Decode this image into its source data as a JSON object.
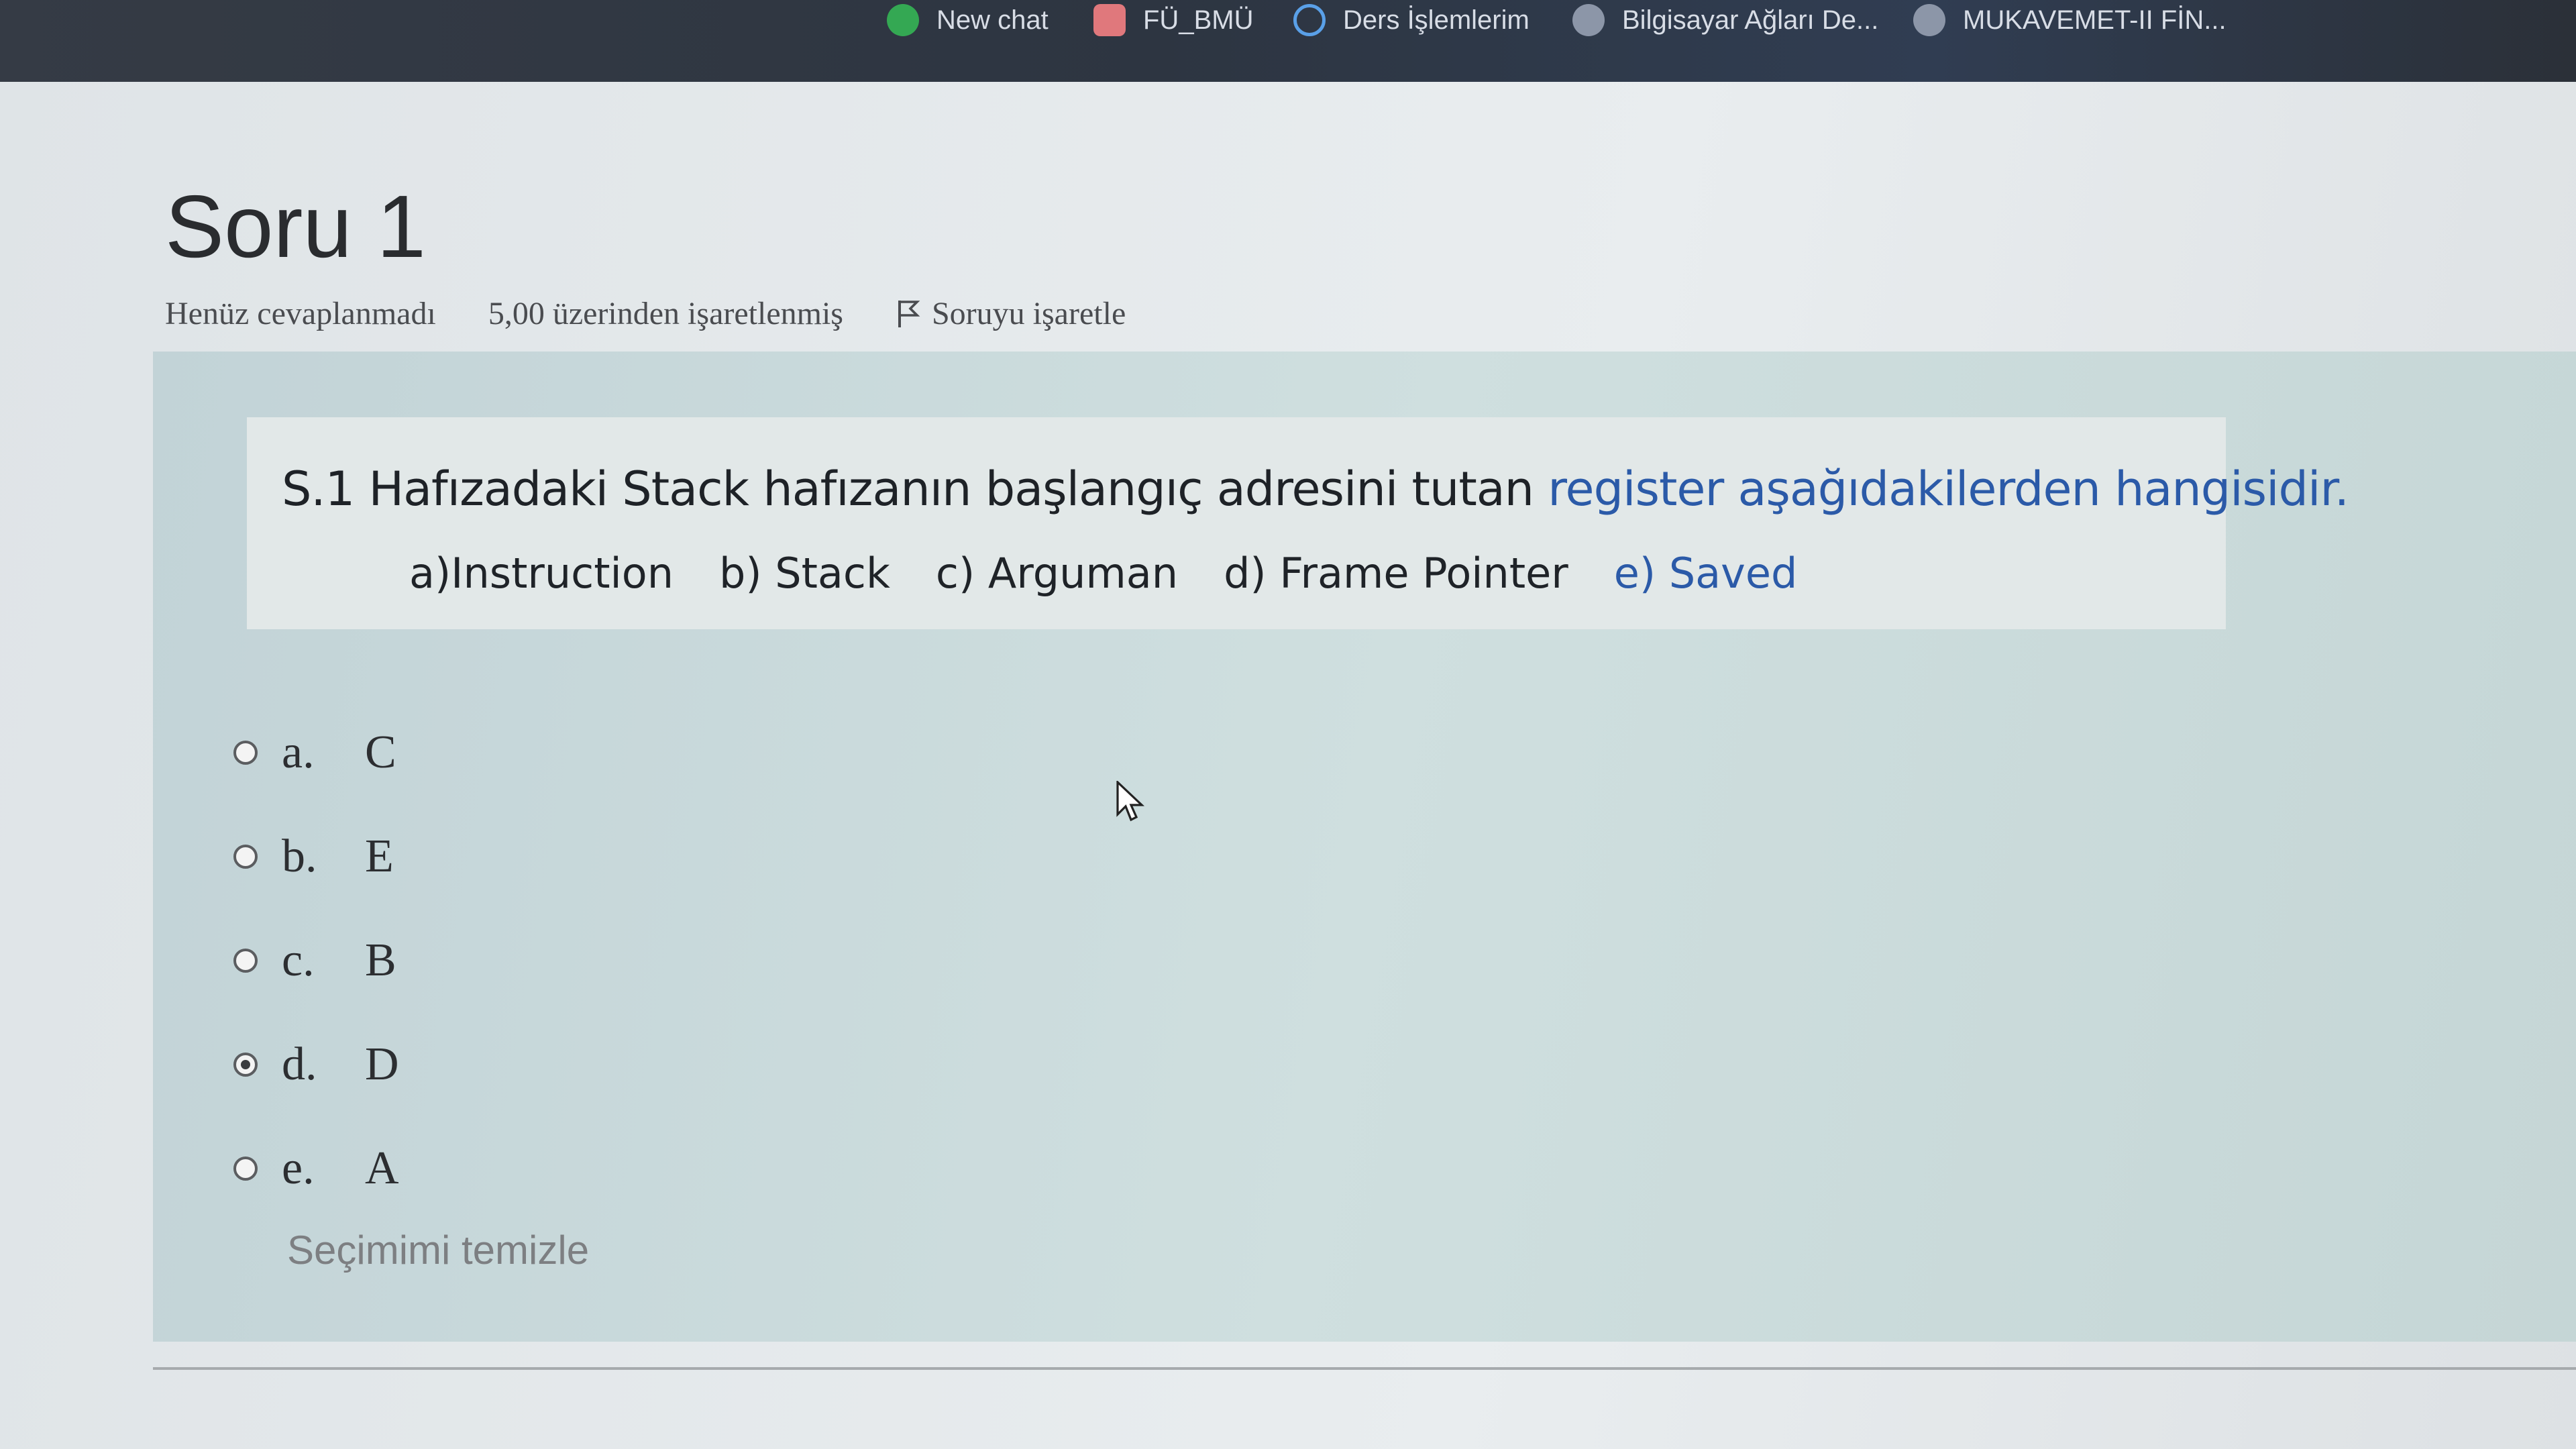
{
  "bookmarks": [
    {
      "label": "New chat",
      "icon": "chat-icon",
      "color": "#34a853"
    },
    {
      "label": "FÜ_BMÜ",
      "icon": "calendar-icon",
      "color": "#e0787c"
    },
    {
      "label": "Ders İşlemlerim",
      "icon": "swirl-logo-icon",
      "color": "#5aa0e8"
    },
    {
      "label": "Bilgisayar Ağları De...",
      "icon": "site-icon",
      "color": "#8c96a8"
    },
    {
      "label": "MUKAVEMET-II FİN...",
      "icon": "site-icon",
      "color": "#8c96a8"
    }
  ],
  "question": {
    "title": "Soru 1",
    "status": "Henüz cevaplanmadı",
    "marks": "5,00 üzerinden işaretlenmiş",
    "flag_label": "Soruyu işaretle",
    "text_part1": "S.1 Hafızadaki Stack hafızanın başlangıç adresini tutan ",
    "text_part2": "register aşağıdakilerden hangisidir.",
    "choices_line": [
      "a)Instruction",
      "b) Stack",
      "c) Arguman",
      "d) Frame Pointer",
      "e) Saved"
    ]
  },
  "answers": [
    {
      "letter": "a.",
      "value": "C",
      "selected": false
    },
    {
      "letter": "b.",
      "value": "E",
      "selected": false
    },
    {
      "letter": "c.",
      "value": "B",
      "selected": false
    },
    {
      "letter": "d.",
      "value": "D",
      "selected": true
    },
    {
      "letter": "e.",
      "value": "A",
      "selected": false
    }
  ],
  "clear_choice_label": "Seçimimi temizle",
  "colors": {
    "accent_blue": "#2b5aa8",
    "panel_bg": "#cfdfdf"
  }
}
